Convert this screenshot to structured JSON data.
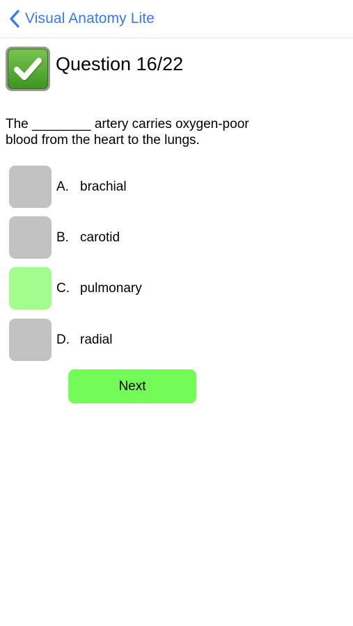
{
  "navbar": {
    "back_label": "Visual Anatomy Lite",
    "back_icon": "chevron-left-icon",
    "accent_color": "#3478f6"
  },
  "header": {
    "status_icon": "checkmark-icon",
    "title": "Question 16/22"
  },
  "question": {
    "line1": "The ________ artery carries oxygen-poor",
    "line2": "blood from the heart to the lungs."
  },
  "options": [
    {
      "letter": "A.",
      "text": "brachial",
      "selected": false
    },
    {
      "letter": "B.",
      "text": "carotid",
      "selected": false
    },
    {
      "letter": "C.",
      "text": "pulmonary",
      "selected": true
    },
    {
      "letter": "D.",
      "text": "radial",
      "selected": false
    }
  ],
  "next_button": {
    "label": "Next",
    "color": "#73fc57"
  },
  "colors": {
    "option_default": "#c2c2c2",
    "option_selected": "#a2fc8e"
  }
}
